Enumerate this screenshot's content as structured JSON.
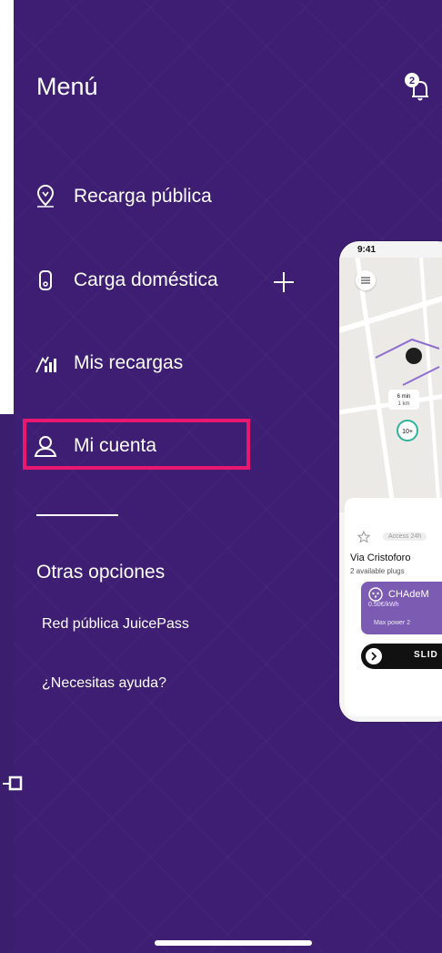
{
  "menu": {
    "title": "Menú",
    "notification_count": "2",
    "items": [
      {
        "label": "Recarga pública",
        "icon": "location-pin-icon"
      },
      {
        "label": "Carga doméstica",
        "icon": "home-charger-icon"
      },
      {
        "label": "Mis recargas",
        "icon": "charging-stats-icon"
      },
      {
        "label": "Mi cuenta",
        "icon": "user-icon"
      }
    ],
    "expand_label": "+"
  },
  "other_options": {
    "title": "Otras opciones",
    "links": [
      {
        "label": "Red pública JuicePass"
      },
      {
        "label": "¿Necesitas ayuda?"
      }
    ]
  },
  "preview": {
    "time": "9:41",
    "route_time": "6 min",
    "route_distance": "1 km",
    "cluster_count": "10+",
    "badge": "Access 24h",
    "station_name": "Via Cristoforo",
    "plugs": "2 available plugs",
    "plug_name": "CHAdeM",
    "plug_price": "0.50€/kWh",
    "max_power": "Max power 2",
    "slide_label": "SLID"
  },
  "colors": {
    "panel": "#3d1e73",
    "highlight": "#e8176f",
    "text": "#ffffff"
  }
}
